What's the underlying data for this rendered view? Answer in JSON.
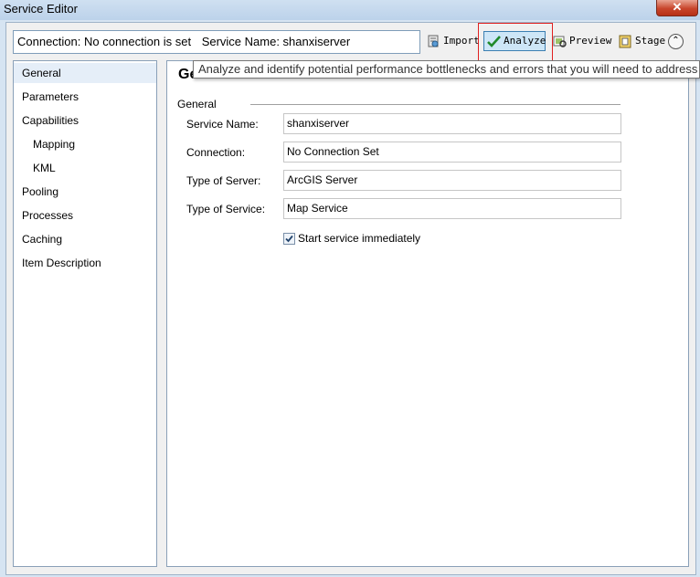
{
  "window": {
    "title": "Service Editor",
    "close_glyph": "✕"
  },
  "toolbar": {
    "connection_text": "Connection: No connection is set",
    "service_name_text": "Service Name: shanxiserver",
    "import_label": "Import",
    "analyze_label": "Analyze",
    "preview_label": "Preview",
    "stage_label": "Stage",
    "collapse_glyph": "⌃"
  },
  "sidebar": {
    "items": [
      {
        "label": "General"
      },
      {
        "label": "Parameters"
      },
      {
        "label": "Capabilities"
      },
      {
        "label": "Mapping"
      },
      {
        "label": "KML"
      },
      {
        "label": "Pooling"
      },
      {
        "label": "Processes"
      },
      {
        "label": "Caching"
      },
      {
        "label": "Item Description"
      }
    ]
  },
  "main": {
    "heading": "Ge",
    "section_label": "General",
    "fields": [
      {
        "label": "Service Name:",
        "value": "shanxiserver"
      },
      {
        "label": "Connection:",
        "value": "No Connection Set"
      },
      {
        "label": "Type of Server:",
        "value": "ArcGIS Server"
      },
      {
        "label": "Type of Service:",
        "value": "Map Service"
      }
    ],
    "start_service_label": "Start service immediately",
    "start_service_checked": true
  },
  "tooltip": {
    "text": "Analyze and identify potential performance bottlenecks and errors that you will need to address"
  },
  "colors": {
    "accent": "#3c7fb1",
    "highlight": "#e02020",
    "selection": "#e5eef8"
  }
}
